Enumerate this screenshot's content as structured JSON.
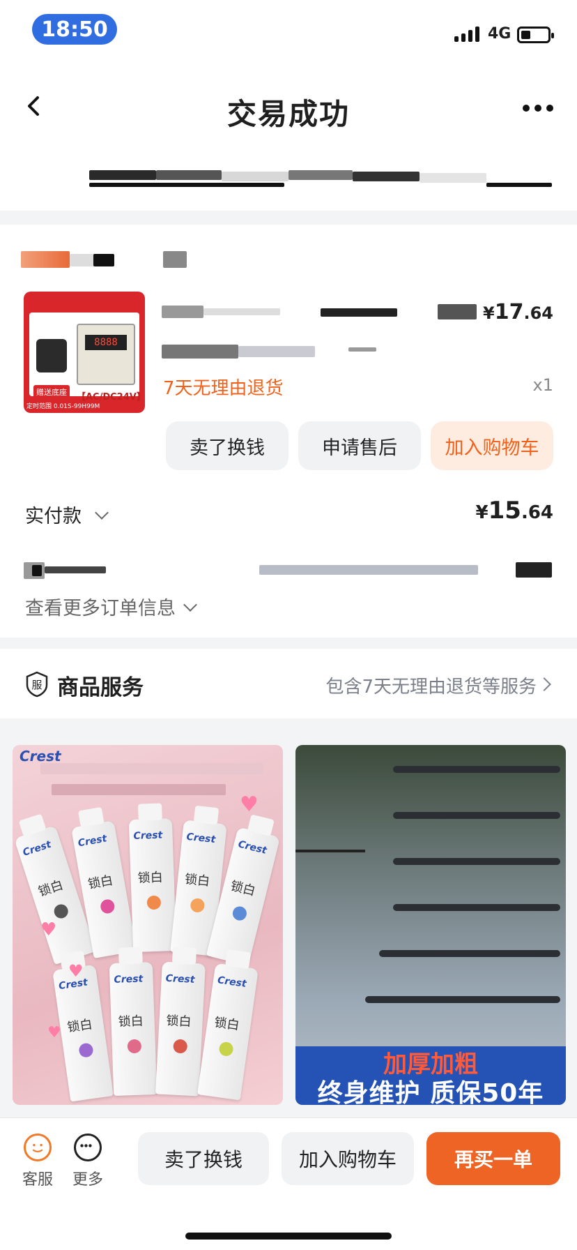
{
  "status_bar": {
    "time": "18:50",
    "network": "4G"
  },
  "nav": {
    "title": "交易成功"
  },
  "order": {
    "product_image": {
      "badge": "赠送底座",
      "spec": "【AC/DC24V】",
      "range": "定时范围 0.01S-99H99M",
      "lcd": "8888"
    },
    "price_symbol": "¥",
    "price_int": "17",
    "price_dec": ".64",
    "refund_tag": "7天无理由退货",
    "quantity": "x1",
    "actions": [
      "卖了换钱",
      "申请售后",
      "加入购物车"
    ],
    "paid_label": "实付款",
    "paid_symbol": "¥",
    "paid_int": "15",
    "paid_dec": ".64",
    "more_info": "查看更多订单信息"
  },
  "service": {
    "icon_text": "服",
    "title": "商品服务",
    "desc": "包含7天无理由退货等服务"
  },
  "recommend": {
    "left": {
      "brand": "Crest",
      "tube_text": "锁白"
    },
    "right": {
      "line1": "加厚加粗",
      "line2": "终身维护 质保50年"
    }
  },
  "bottom_bar": {
    "service_label": "客服",
    "more_label": "更多",
    "sell": "卖了换钱",
    "cart": "加入购物车",
    "rebuy": "再买一单"
  },
  "colors": {
    "accent": "#ee6424",
    "orange_text": "#f0621b",
    "time_pill": "#2f6de0"
  }
}
